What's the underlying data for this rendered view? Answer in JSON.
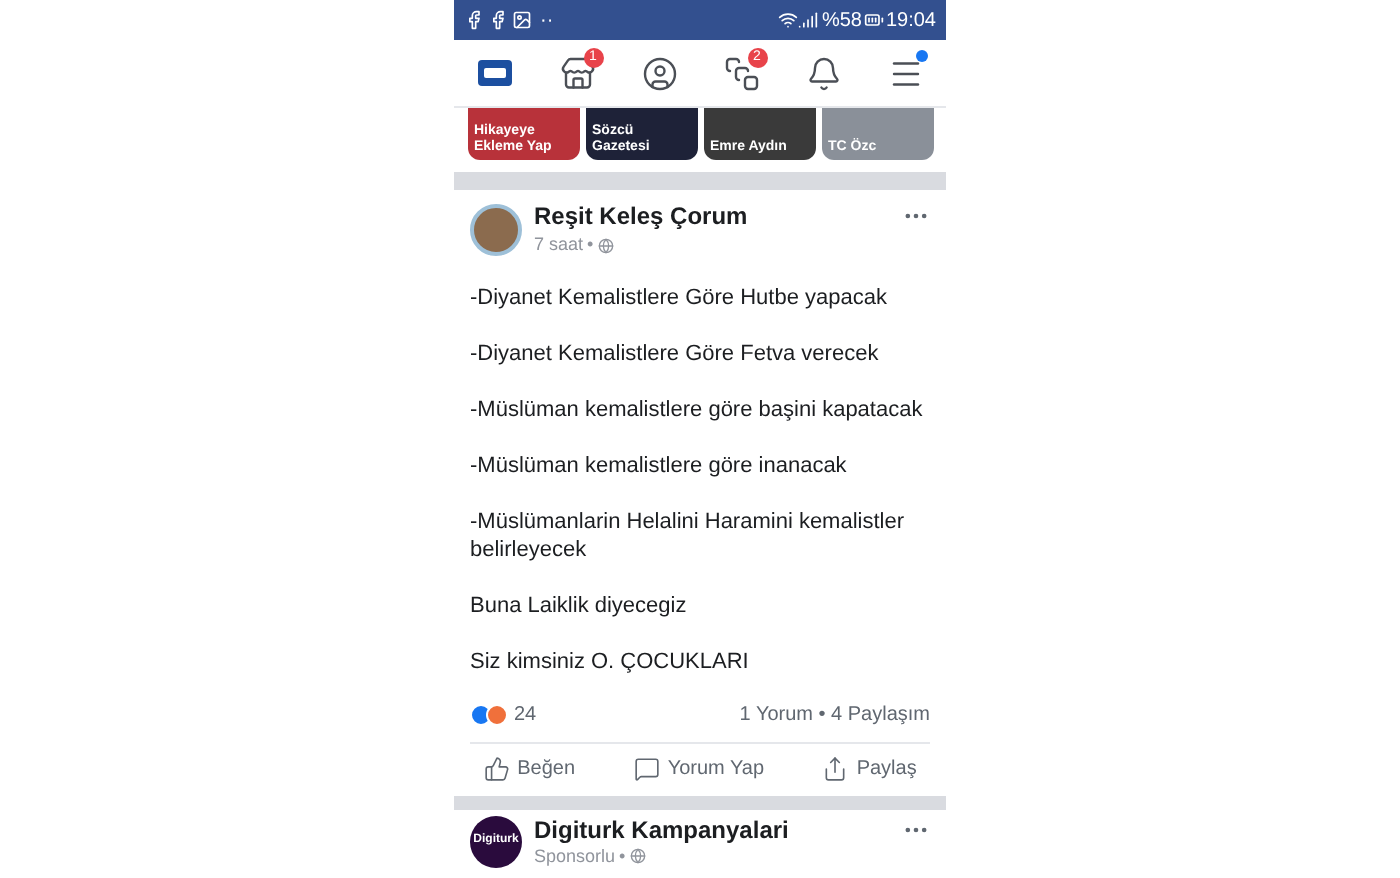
{
  "status_bar": {
    "more": "··",
    "battery": "%58",
    "time": "19:04"
  },
  "nav": {
    "tabs": [
      {
        "kind": "feed",
        "selected": true
      },
      {
        "kind": "market",
        "selected": false,
        "badge": "1"
      },
      {
        "kind": "profile",
        "selected": false
      },
      {
        "kind": "groups",
        "selected": false,
        "badge": "2"
      },
      {
        "kind": "bell",
        "selected": false
      },
      {
        "kind": "menu",
        "selected": false,
        "dot": true
      }
    ]
  },
  "stories": [
    {
      "label": "Hikayeye Ekleme Yap",
      "color": "#b8323a"
    },
    {
      "label": "Sözcü Gazetesi",
      "color": "#1e2238"
    },
    {
      "label": "Emre Aydın",
      "color": "#3a3a3a"
    },
    {
      "label": "TC Özc",
      "color": "#8a9099"
    }
  ],
  "post": {
    "author": "Reşit Keleş Çorum",
    "time": "7 saat",
    "separator": "•",
    "paragraphs": [
      "-Diyanet Kemalistlere Göre Hutbe yapacak",
      "-Diyanet Kemalistlere Göre Fetva verecek",
      "-Müslüman kemalistlere göre başini kapatacak",
      "-Müslüman kemalistlere göre inanacak",
      "-Müslümanlarin Helalini Haramini kemalistler belirleyecek",
      "Buna Laiklik diyecegiz",
      "Siz kimsiniz O. ÇOCUKLARI"
    ],
    "reaction_count": "24",
    "stats": "1 Yorum • 4 Paylaşım",
    "actions": [
      {
        "kind": "like",
        "label": "Beğen"
      },
      {
        "kind": "comment",
        "label": "Yorum Yap"
      },
      {
        "kind": "share",
        "label": "Paylaş"
      }
    ]
  },
  "next_post": {
    "logo": "Digiturk",
    "author": "Digiturk Kampanyalari",
    "subtitle": "Sponsorlu",
    "separator": "•"
  }
}
